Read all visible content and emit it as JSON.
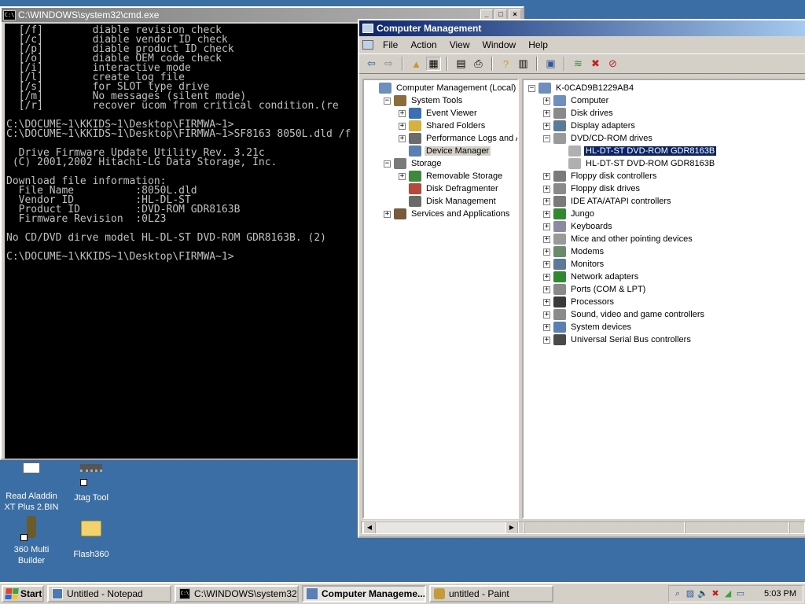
{
  "desktop": {
    "icons": [
      {
        "label": "Read Aladdin XT Plus 2.BIN"
      },
      {
        "label": "Jtag Tool"
      },
      {
        "label": "360 Multi Builder"
      },
      {
        "label": "Flash360"
      }
    ]
  },
  "cmd": {
    "title": "C:\\WINDOWS\\system32\\cmd.exe",
    "lines": [
      "  [/f]        diable revision check",
      "  [/c]        diable vendor ID check",
      "  [/p]        diable product ID check",
      "  [/o]        diable OEM code check",
      "  [/i]        interactive mode",
      "  [/l]        create log file",
      "  [/s]        for SLOT type drive",
      "  [/m]        No messages (silent mode)",
      "  [/r]        recover ucom from critical condition.(re",
      "",
      "C:\\DOCUME~1\\KKIDS~1\\Desktop\\FIRMWA~1>",
      "C:\\DOCUME~1\\KKIDS~1\\Desktop\\FIRMWA~1>SF8163 8050L.dld /f",
      "",
      "  Drive Firmware Update Utility Rev. 3.21c",
      " (C) 2001,2002 Hitachi-LG Data Storage, Inc.",
      "",
      "Download file information:",
      "  File Name          :8050L.dld",
      "  Vendor ID          :HL-DL-ST",
      "  Product ID         :DVD-ROM GDR8163B",
      "  Firmware Revision  :0L23",
      "",
      "No CD/DVD dirve model HL-DL-ST DVD-ROM GDR8163B. (2)",
      "",
      "C:\\DOCUME~1\\KKIDS~1\\Desktop\\FIRMWA~1>"
    ]
  },
  "cm": {
    "title": "Computer Management",
    "menu": [
      "File",
      "Action",
      "View",
      "Window",
      "Help"
    ],
    "left_tree": [
      {
        "label": "Computer Management (Local)",
        "indent": 0,
        "exp": "",
        "color": "#6d8fbf"
      },
      {
        "label": "System Tools",
        "indent": 1,
        "exp": "−",
        "color": "#8b6c3a"
      },
      {
        "label": "Event Viewer",
        "indent": 2,
        "exp": "+",
        "color": "#3b6fb5"
      },
      {
        "label": "Shared Folders",
        "indent": 2,
        "exp": "+",
        "color": "#d6b23c"
      },
      {
        "label": "Performance Logs and Alerts",
        "indent": 2,
        "exp": "+",
        "color": "#6b6b6b"
      },
      {
        "label": "Device Manager",
        "indent": 2,
        "exp": " ",
        "color": "#5a7fb5",
        "sel": true
      },
      {
        "label": "Storage",
        "indent": 1,
        "exp": "−",
        "color": "#7a7a7a"
      },
      {
        "label": "Removable Storage",
        "indent": 2,
        "exp": "+",
        "color": "#3d8a3d"
      },
      {
        "label": "Disk Defragmenter",
        "indent": 2,
        "exp": " ",
        "color": "#b54a3a"
      },
      {
        "label": "Disk Management",
        "indent": 2,
        "exp": " ",
        "color": "#6a6a6a"
      },
      {
        "label": "Services and Applications",
        "indent": 1,
        "exp": "+",
        "color": "#7a5a3a"
      }
    ],
    "right_tree": [
      {
        "label": "K-0CAD9B1229AB4",
        "indent": 0,
        "exp": "−",
        "color": "#6d8fbf"
      },
      {
        "label": "Computer",
        "indent": 1,
        "exp": "+",
        "color": "#6d8fbf"
      },
      {
        "label": "Disk drives",
        "indent": 1,
        "exp": "+",
        "color": "#8a8a8a"
      },
      {
        "label": "Display adapters",
        "indent": 1,
        "exp": "+",
        "color": "#5a7a9a"
      },
      {
        "label": "DVD/CD-ROM drives",
        "indent": 1,
        "exp": "−",
        "color": "#9a9a9a"
      },
      {
        "label": "HL-DT-ST DVD-ROM GDR8163B",
        "indent": 2,
        "exp": "",
        "color": "#b0b0b0",
        "sel": true
      },
      {
        "label": "HL-DT-ST DVD-ROM GDR8163B",
        "indent": 2,
        "exp": "",
        "color": "#b0b0b0"
      },
      {
        "label": "Floppy disk controllers",
        "indent": 1,
        "exp": "+",
        "color": "#7a7a7a"
      },
      {
        "label": "Floppy disk drives",
        "indent": 1,
        "exp": "+",
        "color": "#8a8a8a"
      },
      {
        "label": "IDE ATA/ATAPI controllers",
        "indent": 1,
        "exp": "+",
        "color": "#7a7a7a"
      },
      {
        "label": "Jungo",
        "indent": 1,
        "exp": "+",
        "color": "#2f8a2f"
      },
      {
        "label": "Keyboards",
        "indent": 1,
        "exp": "+",
        "color": "#8a8aa0"
      },
      {
        "label": "Mice and other pointing devices",
        "indent": 1,
        "exp": "+",
        "color": "#9a9a9a"
      },
      {
        "label": "Modems",
        "indent": 1,
        "exp": "+",
        "color": "#6a8a6a"
      },
      {
        "label": "Monitors",
        "indent": 1,
        "exp": "+",
        "color": "#5a7a9a"
      },
      {
        "label": "Network adapters",
        "indent": 1,
        "exp": "+",
        "color": "#2f8a2f"
      },
      {
        "label": "Ports (COM & LPT)",
        "indent": 1,
        "exp": "+",
        "color": "#8a8a8a"
      },
      {
        "label": "Processors",
        "indent": 1,
        "exp": "+",
        "color": "#3a3a3a"
      },
      {
        "label": "Sound, video and game controllers",
        "indent": 1,
        "exp": "+",
        "color": "#8a8a8a"
      },
      {
        "label": "System devices",
        "indent": 1,
        "exp": "+",
        "color": "#5a7fb5"
      },
      {
        "label": "Universal Serial Bus controllers",
        "indent": 1,
        "exp": "+",
        "color": "#4a4a4a"
      }
    ]
  },
  "taskbar": {
    "start": "Start",
    "tasks": [
      {
        "label": "Untitled - Notepad",
        "color": "#4a7ab5"
      },
      {
        "label": "C:\\WINDOWS\\system32...",
        "color": "#000000"
      },
      {
        "label": "Computer Manageme...",
        "color": "#5a7fb5",
        "active": true
      },
      {
        "label": "untitled - Paint",
        "color": "#c49a3a"
      }
    ],
    "clock": "5:03 PM"
  }
}
